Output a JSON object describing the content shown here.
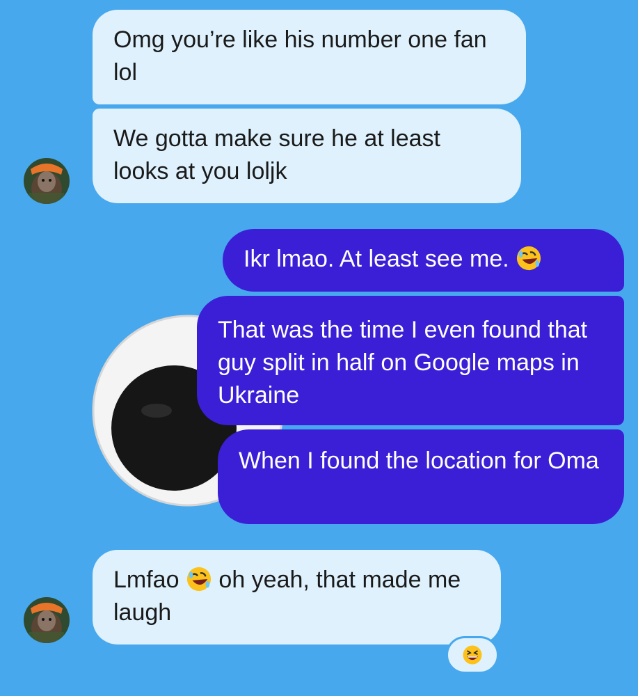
{
  "messages": [
    {
      "direction": "incoming",
      "text": "Omg you’re like his number one fan lol"
    },
    {
      "direction": "incoming",
      "text": "We gotta make sure he at least looks at you loljk"
    },
    {
      "direction": "outgoing",
      "text": "Ikr lmao. At least see me.",
      "emoji": "rolling-on-floor-laughing"
    },
    {
      "direction": "outgoing",
      "text": "That was the time I even found that guy split in half on Google maps in Ukraine"
    },
    {
      "direction": "outgoing",
      "text": "When I found the location for Oma"
    },
    {
      "direction": "incoming",
      "text_before": "Lmfao",
      "emoji": "rolling-on-floor-laughing",
      "text_after": "oh yeah, that made me laugh",
      "reaction": "grinning-squinting-face"
    }
  ],
  "colors": {
    "background": "#47a8ee",
    "incoming_bubble": "#def1fc",
    "outgoing_bubble": "#3a1fd6",
    "incoming_text": "#1a1a1a",
    "outgoing_text": "#ffffff"
  },
  "icons": [
    "avatar",
    "rolling-on-floor-laughing-emoji",
    "grinning-squinting-face-emoji",
    "googly-eye-wallpaper"
  ]
}
